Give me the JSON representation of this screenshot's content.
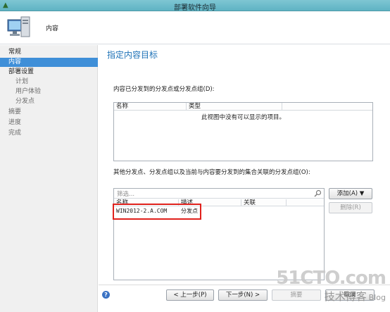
{
  "window": {
    "title": "部署软件向导"
  },
  "header": {
    "title": "内容"
  },
  "sidebar": {
    "items": [
      {
        "label": "常规"
      },
      {
        "label": "内容"
      },
      {
        "label": "部署设置"
      },
      {
        "label": "计划"
      },
      {
        "label": "用户体验"
      },
      {
        "label": "分发点"
      },
      {
        "label": "摘要"
      },
      {
        "label": "进度"
      },
      {
        "label": "完成"
      }
    ]
  },
  "main": {
    "title": "指定内容目标",
    "section1": {
      "label": "内容已分发到的分发点或分发点组(D):",
      "columns": [
        "名称",
        "类型"
      ],
      "empty_message": "此视图中没有可以显示的项目。"
    },
    "section2": {
      "label": "其他分发点、分发点组以及当前与内容要分发到的集合关联的分发点组(O):",
      "filter_placeholder": "筛选...",
      "columns": [
        "名称",
        "描述",
        "关联"
      ],
      "rows": [
        {
          "name": "WIN2012-2.A.COM",
          "desc": "分发点"
        }
      ]
    },
    "buttons": {
      "add": "添加(A) ▼",
      "remove": "删除(R)"
    }
  },
  "footer": {
    "prev": "< 上一步(P)",
    "next": "下一步(N) >",
    "summary": "摘要",
    "cancel": "取消"
  },
  "watermark": {
    "line1": "51CTO.com",
    "line2": "技术博客",
    "line3": "Blog"
  },
  "colors": {
    "accent": "#3f8fd8",
    "title_blue": "#1e72b7",
    "highlight_red": "#e0211c"
  }
}
